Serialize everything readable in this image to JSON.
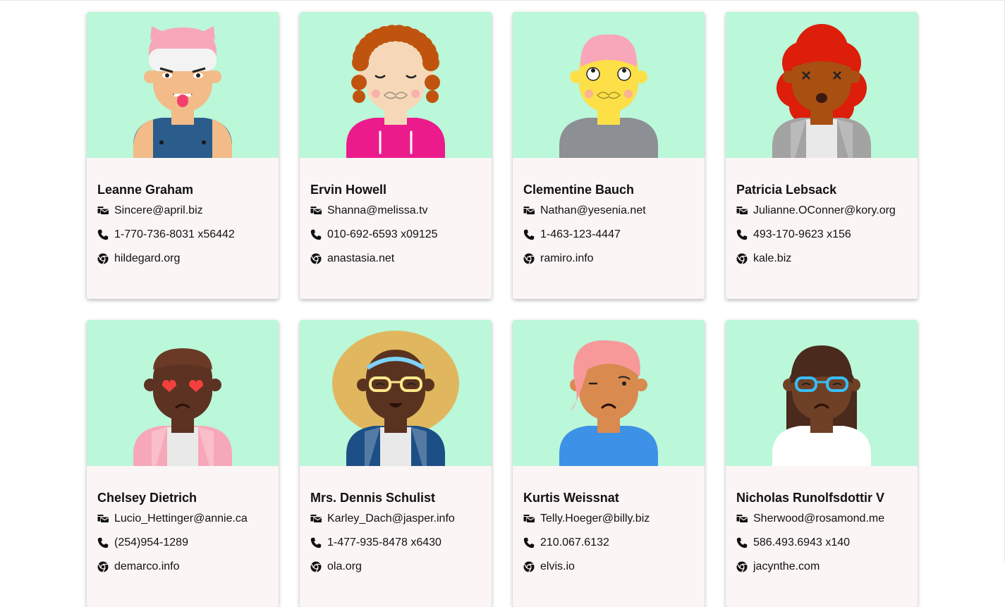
{
  "users": [
    {
      "name": "Leanne Graham",
      "email": "Sincere@april.biz",
      "phone": "1-770-736-8031 x56442",
      "website": "hildegard.org",
      "avatar": {
        "skin": "#f2bb88",
        "hair": "#f8a7b8",
        "style": "cat-hat",
        "shirt": "#2b5d8c",
        "eyes": "angry",
        "mouth": "tongue"
      }
    },
    {
      "name": "Ervin Howell",
      "email": "Shanna@melissa.tv",
      "phone": "010-692-6593 x09125",
      "website": "anastasia.net",
      "avatar": {
        "skin": "#f6d8b8",
        "hair": "#c0540f",
        "style": "curly",
        "shirt": "#ec1b8c",
        "eyes": "closed",
        "mouth": "puffy"
      }
    },
    {
      "name": "Clementine Bauch",
      "email": "Nathan@yesenia.net",
      "phone": "1-463-123-4447",
      "website": "ramiro.info",
      "avatar": {
        "skin": "#fde047",
        "hair": "#f8a7b8",
        "style": "short",
        "shirt": "#8c8f94",
        "eyes": "rolled",
        "mouth": "puffy"
      }
    },
    {
      "name": "Patricia Lebsack",
      "email": "Julianne.OConner@kory.org",
      "phone": "493-170-9623 x156",
      "website": "kale.biz",
      "avatar": {
        "skin": "#a84f12",
        "hair": "#dc1e0a",
        "style": "afro",
        "shirt": "#a3a3a3",
        "eyes": "x",
        "mouth": "open"
      }
    },
    {
      "name": "Chelsey Dietrich",
      "email": "Lucio_Hettinger@annie.ca",
      "phone": "(254)954-1289",
      "website": "demarco.info",
      "avatar": {
        "skin": "#5c3322",
        "hair": "#6a3a26",
        "style": "buzz",
        "shirt": "#f7a8b8",
        "eyes": "hearts",
        "mouth": "sad"
      }
    },
    {
      "name": "Mrs. Dennis Schulist",
      "email": "Karley_Dach@jasper.info",
      "phone": "1-477-935-8478 x6430",
      "website": "ola.org",
      "avatar": {
        "skin": "#5a3320",
        "hair": "#e0b75e",
        "style": "big-afro",
        "shirt": "#1c4f86",
        "eyes": "glasses-yellow",
        "mouth": "smile"
      }
    },
    {
      "name": "Kurtis Weissnat",
      "email": "Telly.Hoeger@billy.biz",
      "phone": "210.067.6132",
      "website": "elvis.io",
      "avatar": {
        "skin": "#d98a4e",
        "hair": "#f79999",
        "style": "swoop",
        "shirt": "#3d91e6",
        "eyes": "wink",
        "mouth": "sad"
      }
    },
    {
      "name": "Nicholas Runolfsdottir V",
      "email": "Sherwood@rosamond.me",
      "phone": "586.493.6943 x140",
      "website": "jacynthe.com",
      "avatar": {
        "skin": "#6e4025",
        "hair": "#4a2a1c",
        "style": "long",
        "shirt": "#ffffff",
        "eyes": "glasses-blue",
        "mouth": "sad"
      }
    }
  ],
  "colors": {
    "avatar_bg": "#bbf7d9",
    "card_bg": "#fbf5f5"
  },
  "icons": {
    "email": "mail-bulk-icon",
    "phone": "phone-icon",
    "website": "chrome-icon"
  }
}
